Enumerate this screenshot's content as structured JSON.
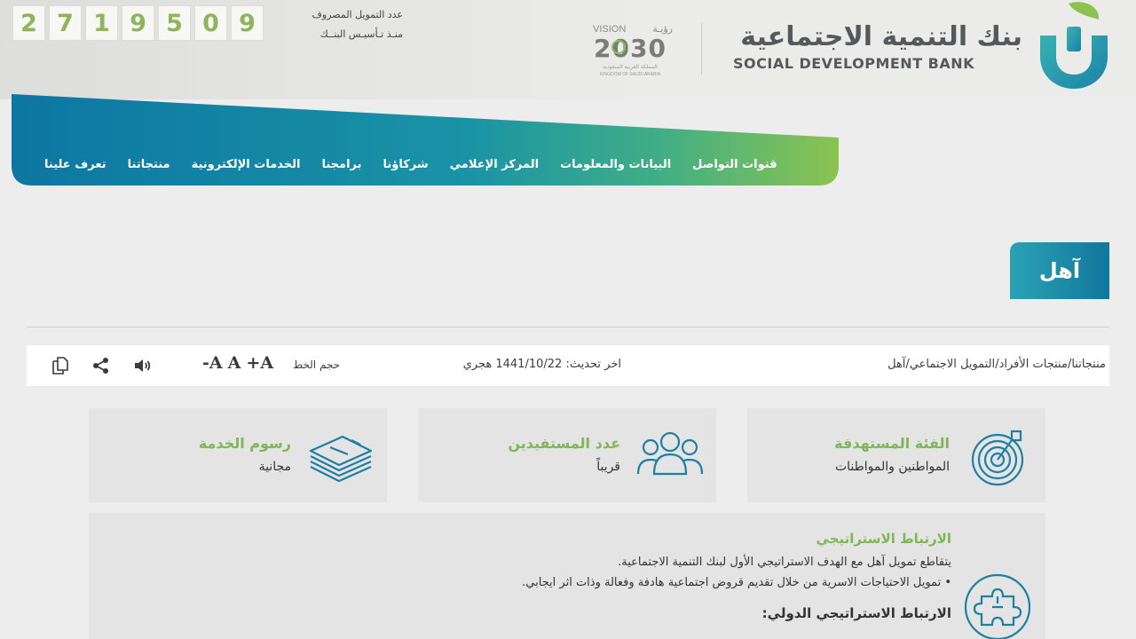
{
  "header": {
    "counter_digits": [
      "2",
      "7",
      "1",
      "9",
      "5",
      "0",
      "9"
    ],
    "counter_label_line1": "عدد التمويل المصروف",
    "counter_label_line2": "منـذ تـأسيـس البنــك",
    "vision_en": "VISION",
    "vision_ar": "رؤيـة",
    "vision_year": "2030",
    "vision_kingdom_ar": "المملكة العربية السعودية",
    "vision_kingdom_en": "KINGDOM OF SAUDI ARABIA",
    "bank_name_ar": "بنك التنمية الاجتماعية",
    "bank_name_en": "SOCIAL DEVELOPMENT BANK"
  },
  "nav": {
    "items": [
      {
        "label": "تعرف علينا"
      },
      {
        "label": "منتجاتنا"
      },
      {
        "label": "الخدمات الإلكترونية"
      },
      {
        "label": "برامجنا"
      },
      {
        "label": "شركاؤنا"
      },
      {
        "label": "المركز الإعلامي"
      },
      {
        "label": "البيانات والمعلومات"
      },
      {
        "label": "قنوات التواصل"
      }
    ]
  },
  "page": {
    "title": "آهل"
  },
  "toolbar": {
    "breadcrumb": [
      "منتجاتنا",
      "منتجات الأفراد",
      "التمويل الاجتماعي",
      "آهل"
    ],
    "breadcrumb_sep": "/",
    "updated_label": "اخر تحديث:",
    "updated_value": "1441/10/22 هجري",
    "font_size_label": "حجم الخط",
    "font_increase": "A+",
    "font_normal": "A",
    "font_decrease": "A-"
  },
  "cards": [
    {
      "title": "الفئة المستهدفة",
      "value": "المواطنين والمواطنات",
      "icon": "target-icon"
    },
    {
      "title": "عدد المستفيدين",
      "value": "قريباً",
      "icon": "users-group-icon"
    },
    {
      "title": "رسوم الخدمة",
      "value": "مجانية",
      "icon": "money-stack-icon"
    }
  ],
  "strategic": {
    "heading": "الارتباط الاستراتيجي",
    "line1": "يتقاطع تمويل آهل مع الهدف الاستراتيجي الأول لبنك التنمية الاجتماعية.",
    "line2": "• تمويل الاحتياجات الاسرية من خلال تقديم قروض اجتماعية هادفة وفعالة وذات اثر ايجابي.",
    "heading2": "الارتباط الاستراتيجي الدولي:",
    "icon": "puzzle-icon"
  },
  "colors": {
    "accent_green": "#7fb657",
    "nav_teal": "#0f7aa3",
    "nav_green": "#8cc350",
    "counter_green": "#8db65c"
  }
}
